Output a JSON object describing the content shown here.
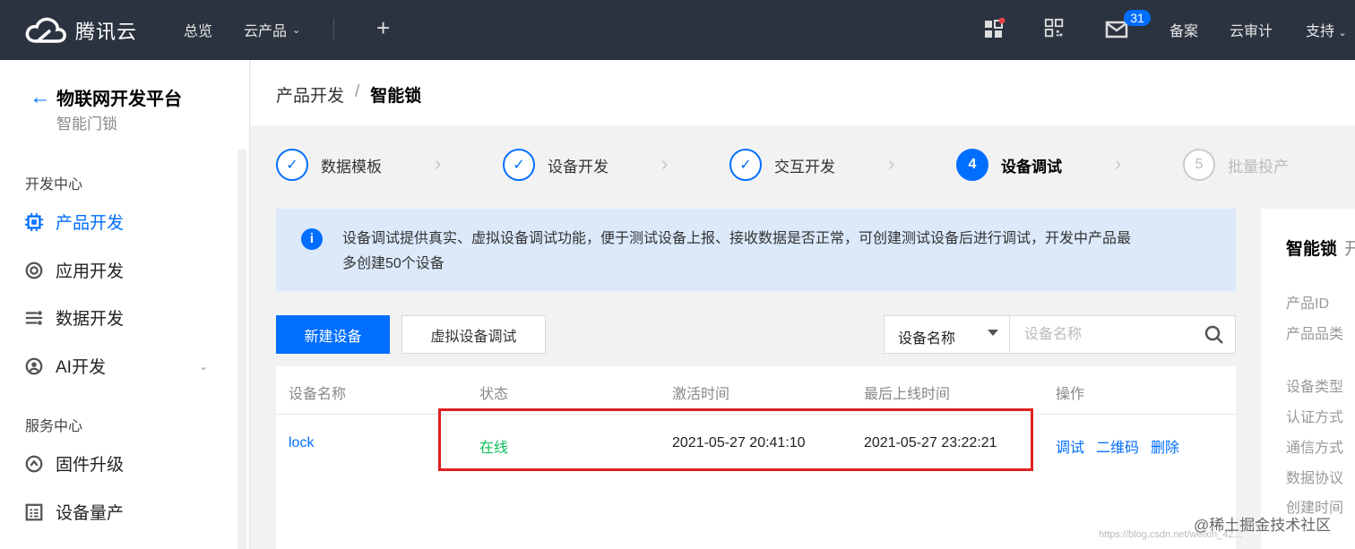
{
  "topbar": {
    "brand": "腾讯云",
    "nav": {
      "overview": "总览",
      "products": "云产品"
    },
    "message_count": "31",
    "right_links": [
      "备案",
      "云审计",
      "支持"
    ]
  },
  "sidebar": {
    "title": "物联网开发平台",
    "subtitle": "智能门锁",
    "groups": [
      {
        "title": "开发中心",
        "items": [
          {
            "label": "产品开发",
            "icon": "chip-icon",
            "active": true
          },
          {
            "label": "应用开发",
            "icon": "app-icon"
          },
          {
            "label": "数据开发",
            "icon": "data-flow-icon"
          },
          {
            "label": "AI开发",
            "icon": "ai-icon",
            "expandable": true
          }
        ]
      },
      {
        "title": "服务中心",
        "items": [
          {
            "label": "固件升级",
            "icon": "firmware-icon"
          },
          {
            "label": "设备量产",
            "icon": "batch-icon"
          }
        ]
      }
    ]
  },
  "breadcrumb": {
    "parent": "产品开发",
    "separator": "/",
    "current": "智能锁"
  },
  "steps": [
    {
      "label": "数据模板",
      "state": "done"
    },
    {
      "label": "设备开发",
      "state": "done"
    },
    {
      "label": "交互开发",
      "state": "done"
    },
    {
      "label": "设备调试",
      "state": "current",
      "num": "4"
    },
    {
      "label": "批量投产",
      "state": "todo",
      "num": "5"
    }
  ],
  "info": {
    "line1": "设备调试提供真实、虚拟设备调试功能，便于测试设备上报、接收数据是否正常，可创建测试设备后进行调试，开发中产品最",
    "line2": "多创建50个设备"
  },
  "toolbar": {
    "new_device": "新建设备",
    "virtual_debug": "虚拟设备调试",
    "filter_select": "设备名称",
    "search_placeholder": "设备名称"
  },
  "table": {
    "headers": [
      "设备名称",
      "状态",
      "激活时间",
      "最后上线时间",
      "操作"
    ],
    "rows": [
      {
        "name": "lock",
        "status": "在线",
        "activated": "2021-05-27 20:41:10",
        "last_online": "2021-05-27 23:22:21",
        "actions": [
          "调试",
          "二维码",
          "删除"
        ]
      }
    ]
  },
  "right_panel": {
    "title": "智能锁",
    "title_tail": "开",
    "labels": [
      "产品ID",
      "产品品类",
      "设备类型",
      "认证方式",
      "通信方式",
      "数据协议",
      "创建时间"
    ]
  },
  "watermark": "@稀土掘金技术社区",
  "watermark_url": "https://blog.csdn.net/weixin_42..."
}
